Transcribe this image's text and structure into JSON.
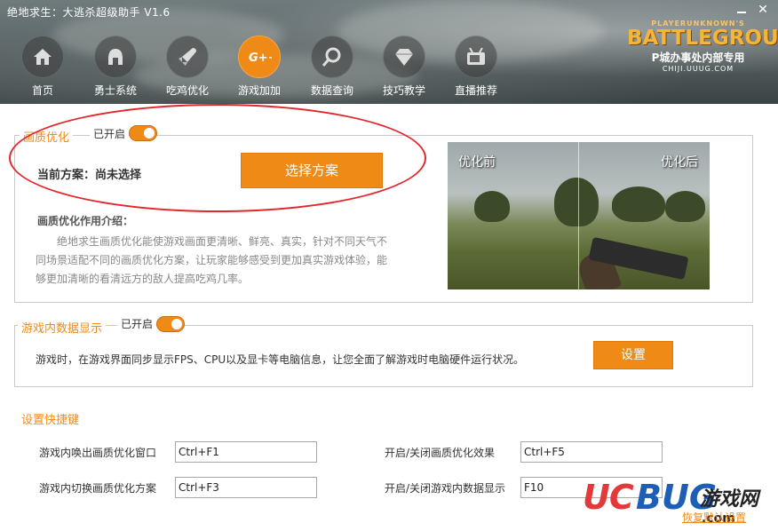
{
  "window": {
    "title": "绝地求生：大逃杀超级助手 V1.6"
  },
  "nav": {
    "items": [
      {
        "label": "首页",
        "icon": "home-icon"
      },
      {
        "label": "勇士系统",
        "icon": "helmet-icon"
      },
      {
        "label": "吃鸡优化",
        "icon": "rocket-icon"
      },
      {
        "label": "游戏加加",
        "icon": "gplus-icon",
        "active": true
      },
      {
        "label": "数据查询",
        "icon": "search-icon"
      },
      {
        "label": "技巧教学",
        "icon": "diamond-icon"
      },
      {
        "label": "直播推荐",
        "icon": "tv-icon"
      }
    ]
  },
  "logo": {
    "top": "PLAYERUNKNOWN'S",
    "main": "BATTLEGROUNDS",
    "sub": "P城办事处内部专用",
    "url": "CHIJI.UUUG.COM"
  },
  "quality": {
    "legend": "画质优化",
    "toggle_label": "已开启",
    "toggle_on": true,
    "plan_label": "当前方案：尚未选择",
    "choose_button": "选择方案",
    "intro_title": "画质优化作用介绍：",
    "intro_text": "绝地求生画质优化能使游戏画面更清晰、鲜亮、真实，针对不同天气不同场景适配不同的画质优化方案，让玩家能够感受到更加真实游戏体验，能够更加清晰的看清远方的敌人提高吃鸡几率。",
    "preview_before": "优化前",
    "preview_after": "优化后"
  },
  "ingame": {
    "legend": "游戏内数据显示",
    "toggle_label": "已开启",
    "toggle_on": true,
    "description": "游戏时，在游戏界面同步显示FPS、CPU以及显卡等电脑信息，让您全面了解游戏时电脑硬件运行状况。",
    "settings_button": "设置"
  },
  "hotkeys": {
    "title": "设置快捷键",
    "items": [
      {
        "label": "游戏内唤出画质优化窗口",
        "value": "Ctrl+F1"
      },
      {
        "label": "游戏内切换画质优化方案",
        "value": "Ctrl+F3"
      },
      {
        "label": "开启/关闭画质优化效果",
        "value": "Ctrl+F5"
      },
      {
        "label": "开启/关闭游戏内数据显示",
        "value": "F10"
      }
    ]
  },
  "footer": {
    "reset_link": "恢复默认设置",
    "watermark_uc": "UC",
    "watermark_bug": "BUG",
    "watermark_cn": "游戏网",
    "watermark_com": ".com"
  },
  "colors": {
    "accent": "#f08a17",
    "highlight_ellipse": "#e2262c"
  }
}
